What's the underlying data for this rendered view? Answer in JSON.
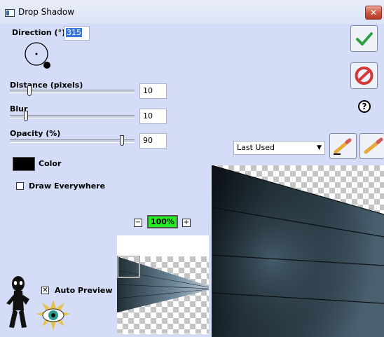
{
  "window": {
    "title": "Drop Shadow",
    "close_label": "✕"
  },
  "direction": {
    "label": "Direction (°):",
    "value": "315"
  },
  "distance": {
    "label": "Distance (pixels)",
    "value": "10",
    "slider_fraction": 0.16
  },
  "blur": {
    "label": "Blur",
    "value": "10",
    "slider_fraction": 0.13
  },
  "opacity": {
    "label": "Opacity (%)",
    "value": "90",
    "slider_fraction": 0.9
  },
  "color": {
    "label": "Color",
    "swatch": "#000000"
  },
  "draw_everywhere": {
    "label": "Draw Everywhere",
    "checked": false
  },
  "preset": {
    "selected": "Last Used"
  },
  "zoom": {
    "minus": "−",
    "value": "100%",
    "plus": "+"
  },
  "auto_preview": {
    "label": "Auto Preview",
    "checked": true,
    "check_glyph": "✕"
  },
  "buttons": {
    "ok_icon": "checkmark-icon",
    "cancel_icon": "no-entry-icon",
    "help_label": "?"
  },
  "colors": {
    "dialog_bg": "#d4dcf7",
    "ok_green": "#2ea043",
    "cancel_red": "#d23a3a",
    "zoom_green": "#22ee22"
  }
}
